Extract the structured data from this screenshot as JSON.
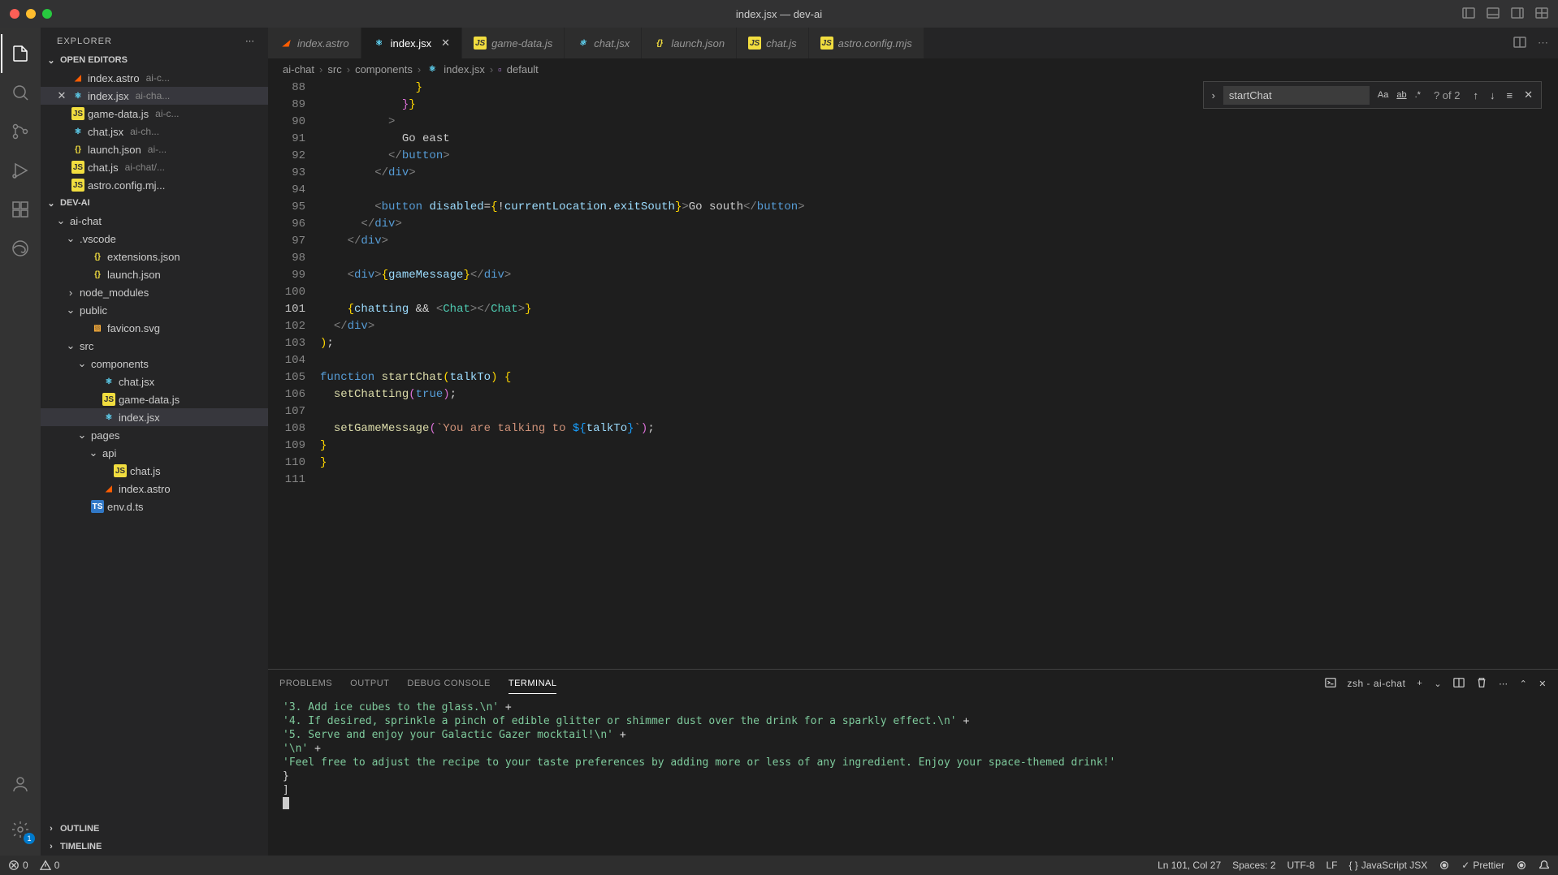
{
  "window": {
    "title": "index.jsx — dev-ai"
  },
  "sidebar": {
    "title": "EXPLORER",
    "sections": {
      "openEditors": {
        "label": "OPEN EDITORS",
        "items": [
          {
            "name": "index.astro",
            "hint": "ai-c...",
            "iconType": "astro",
            "marker": ""
          },
          {
            "name": "index.jsx",
            "hint": "ai-cha...",
            "iconType": "react",
            "marker": "close",
            "active": true
          },
          {
            "name": "game-data.js",
            "hint": "ai-c...",
            "iconType": "js",
            "marker": ""
          },
          {
            "name": "chat.jsx",
            "hint": "ai-ch...",
            "iconType": "react",
            "marker": ""
          },
          {
            "name": "launch.json",
            "hint": "ai-...",
            "iconType": "json",
            "marker": ""
          },
          {
            "name": "chat.js",
            "hint": "ai-chat/...",
            "iconType": "js",
            "marker": ""
          },
          {
            "name": "astro.config.mj...",
            "hint": "",
            "iconType": "js",
            "marker": ""
          }
        ]
      },
      "projectLabel": "DEV-AI",
      "tree": [
        {
          "type": "folder",
          "name": "ai-chat",
          "depth": 1,
          "open": true
        },
        {
          "type": "folder",
          "name": ".vscode",
          "depth": 2,
          "open": true
        },
        {
          "type": "file",
          "name": "extensions.json",
          "depth": 3,
          "icon": "json"
        },
        {
          "type": "file",
          "name": "launch.json",
          "depth": 3,
          "icon": "json"
        },
        {
          "type": "folder",
          "name": "node_modules",
          "depth": 2,
          "open": false
        },
        {
          "type": "folder",
          "name": "public",
          "depth": 2,
          "open": true
        },
        {
          "type": "file",
          "name": "favicon.svg",
          "depth": 3,
          "icon": "svg"
        },
        {
          "type": "folder",
          "name": "src",
          "depth": 2,
          "open": true
        },
        {
          "type": "folder",
          "name": "components",
          "depth": 3,
          "open": true
        },
        {
          "type": "file",
          "name": "chat.jsx",
          "depth": 4,
          "icon": "react"
        },
        {
          "type": "file",
          "name": "game-data.js",
          "depth": 4,
          "icon": "js"
        },
        {
          "type": "file",
          "name": "index.jsx",
          "depth": 4,
          "icon": "react",
          "active": true
        },
        {
          "type": "folder",
          "name": "pages",
          "depth": 3,
          "open": true
        },
        {
          "type": "folder",
          "name": "api",
          "depth": 4,
          "open": true
        },
        {
          "type": "file",
          "name": "chat.js",
          "depth": 5,
          "icon": "js"
        },
        {
          "type": "file",
          "name": "index.astro",
          "depth": 4,
          "icon": "astro"
        },
        {
          "type": "file",
          "name": "env.d.ts",
          "depth": 3,
          "icon": "ts"
        }
      ],
      "outline": "OUTLINE",
      "timeline": "TIMELINE"
    }
  },
  "tabs": [
    {
      "name": "index.astro",
      "icon": "astro",
      "active": false,
      "italic": true
    },
    {
      "name": "index.jsx",
      "icon": "react",
      "active": true,
      "close": true
    },
    {
      "name": "game-data.js",
      "icon": "js",
      "active": false,
      "italic": true
    },
    {
      "name": "chat.jsx",
      "icon": "react",
      "active": false,
      "italic": true
    },
    {
      "name": "launch.json",
      "icon": "json",
      "active": false,
      "italic": true
    },
    {
      "name": "chat.js",
      "icon": "js",
      "active": false,
      "italic": true
    },
    {
      "name": "astro.config.mjs",
      "icon": "js",
      "active": false,
      "italic": true
    }
  ],
  "breadcrumb": [
    "ai-chat",
    "src",
    "components",
    "index.jsx",
    "default"
  ],
  "find": {
    "value": "startChat",
    "count": "? of 2"
  },
  "code": {
    "startLine": 88,
    "currentLine": 101
  },
  "panel": {
    "tabs": [
      "PROBLEMS",
      "OUTPUT",
      "DEBUG CONSOLE",
      "TERMINAL"
    ],
    "activeTab": 3,
    "terminalLabel": "zsh - ai-chat",
    "lines": [
      {
        "str": "'3. Add ice cubes to the glass.\\n'",
        "suffix": " +"
      },
      {
        "str": "'4. If desired, sprinkle a pinch of edible glitter or shimmer dust over the drink for a sparkly effect.\\n'",
        "suffix": " +"
      },
      {
        "str": "'5. Serve and enjoy your Galactic Gazer mocktail!\\n'",
        "suffix": " +"
      },
      {
        "str": "'\\n'",
        "suffix": " +"
      },
      {
        "str": "'Feel free to adjust the recipe to your taste preferences by adding more or less of any ingredient. Enjoy your space-themed drink!'",
        "suffix": ""
      }
    ],
    "tail": [
      "  }",
      "]"
    ]
  },
  "status": {
    "errors": "0",
    "warnings": "0",
    "cursor": "Ln 101, Col 27",
    "spaces": "Spaces: 2",
    "encoding": "UTF-8",
    "eol": "LF",
    "lang": "JavaScript JSX",
    "prettier": "Prettier"
  }
}
